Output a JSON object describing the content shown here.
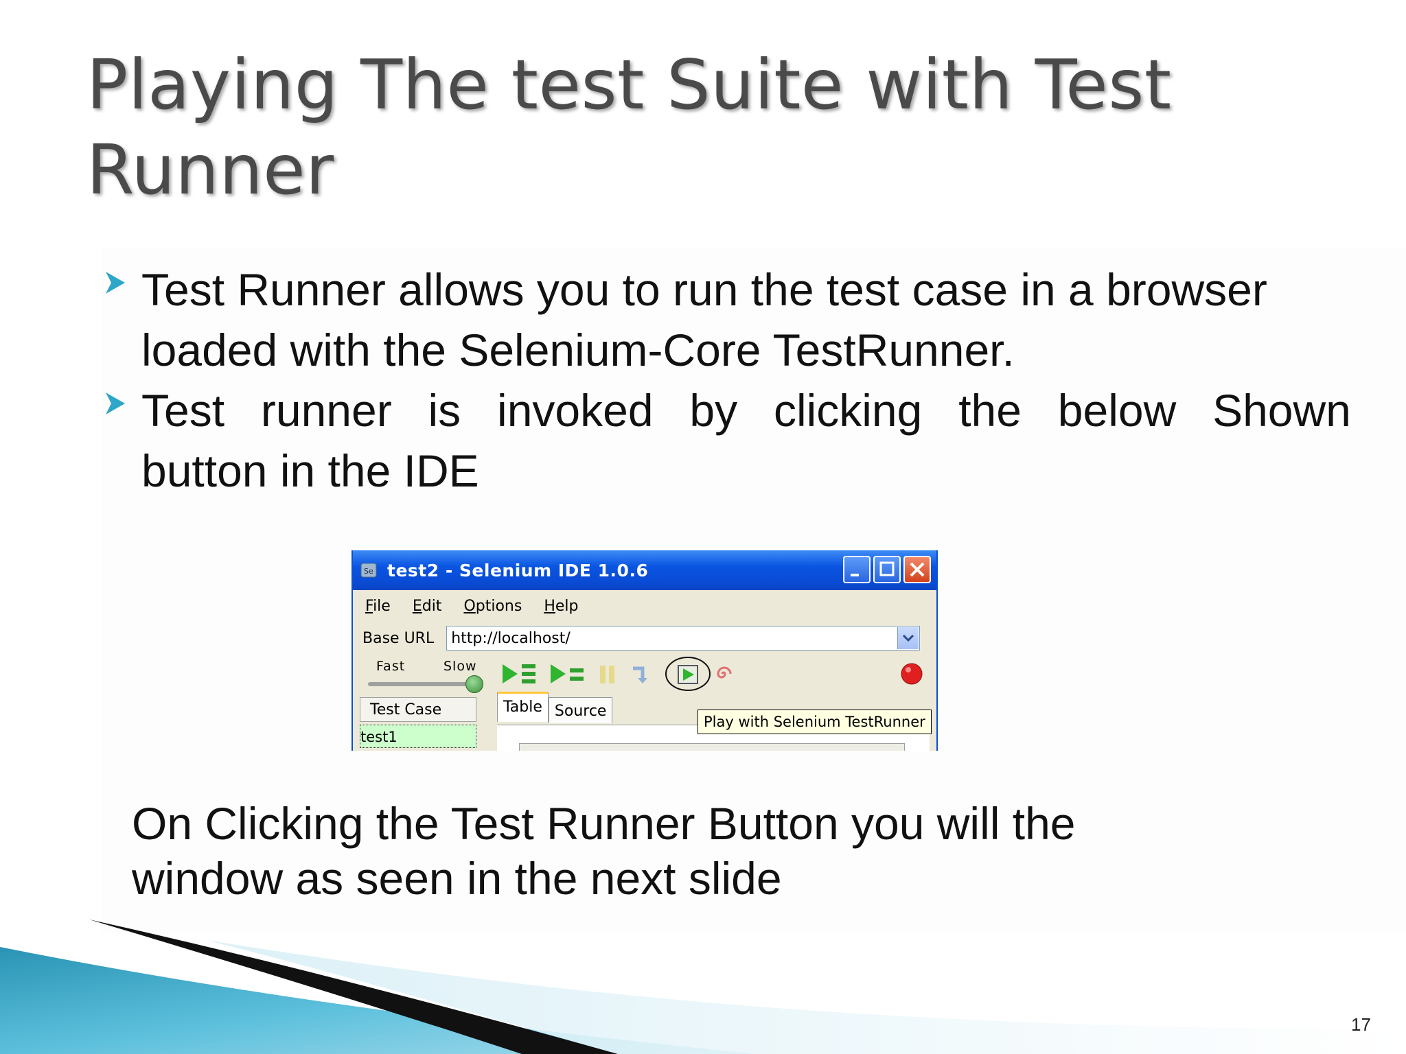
{
  "slide": {
    "title": "Playing The test Suite with Test Runner",
    "bullets": [
      {
        "line1": "Test Runner allows you to run the test case in a browser",
        "line2": "loaded with the Selenium-Core  TestRunner."
      },
      {
        "line1_words": [
          "Test",
          "runner",
          "is",
          "invoked",
          "by",
          "clicking",
          "the",
          "below",
          "Shown"
        ],
        "line2": "button in the IDE"
      }
    ],
    "note_line1": "On Clicking the Test Runner Button you will the",
    "note_line2": "window as seen in the next slide",
    "page_number": "17"
  },
  "ide": {
    "window_title": "test2 - Selenium IDE 1.0.6",
    "menu": [
      "File",
      "Edit",
      "Options",
      "Help"
    ],
    "base_url_label": "Base URL",
    "base_url_value": "http://localhost/",
    "speed_fast": "Fast",
    "speed_slow": "Slow",
    "testcase_header": "Test Case",
    "testcase_item": "test1",
    "tab_table": "Table",
    "tab_source": "Source",
    "tooltip": "Play with Selenium TestRunner"
  },
  "colors": {
    "title_text": "#4a4a4a",
    "bullet_marker": "#2ea6c8",
    "xp_titlebar": "#0a55e2",
    "record_button": "#e02020",
    "swoosh_teal": "#2a93b4"
  }
}
